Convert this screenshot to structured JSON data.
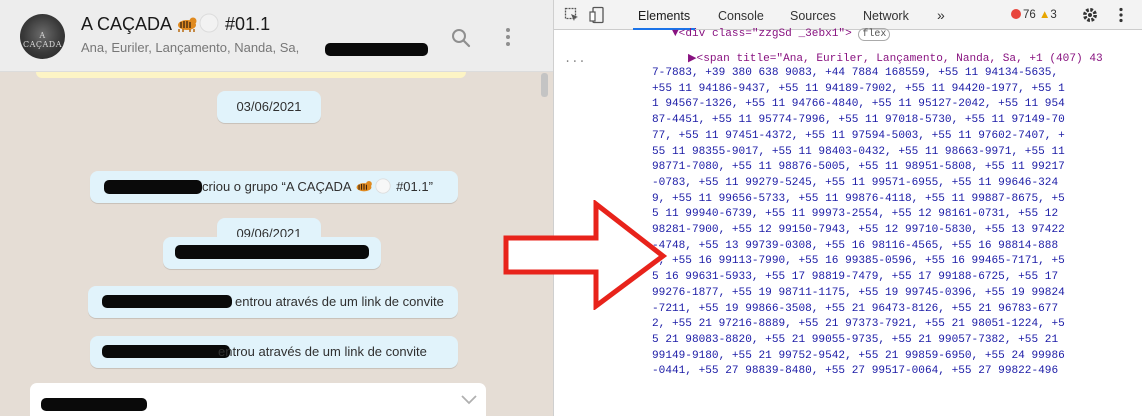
{
  "chat": {
    "avatar_text": "A CAÇADA",
    "title_prefix": "A CAÇADA ",
    "title_suffix": " #01.1",
    "subtitle": "Ana, Euriler, Lançamento, Nanda, Sa,",
    "icons": {
      "search": "search-icon",
      "menu": "kebab-menu-icon",
      "title_emoji": "tiger-emoji",
      "bubble": "chevron-down-icon"
    },
    "colors": {
      "panel_bg": "#e5ddd5",
      "system_pill": "#e1f3fb",
      "header_bg": "#ededed"
    },
    "messages": [
      {
        "text": "03/06/2021"
      },
      {
        "text": " criou o grupo “A CAÇADA ",
        "tail": " #01.1”"
      },
      {
        "text": "09/06/2021"
      },
      {
        "text": ""
      },
      {
        "text": "entrou através de um link de convite"
      },
      {
        "text": "entrou através de um link de convite"
      }
    ]
  },
  "devtools": {
    "tabs": [
      "Elements",
      "Console",
      "Sources",
      "Network",
      "»"
    ],
    "errors": "76",
    "warnings": "3",
    "icons": {
      "inspect": "inspect-element-icon",
      "device": "device-toolbar-icon",
      "settings": "gear-icon",
      "more": "vertical-dots-icon",
      "error": "error-dot-icon",
      "warning": "warning-triangle-icon"
    },
    "colors": {
      "tag": "#881280",
      "attr": "#994500",
      "value": "#1a1aa6",
      "active_tab": "#1a73e8"
    },
    "ellipsis": "...",
    "line0": {
      "pre": "▼<div class=\"zzgSd _3ebx1\">",
      "badge": "flex"
    },
    "line1": {
      "pre": "▶<span title=\"Ana, Euriler, Lançamento, Nanda, Sa, +1 (407) 43"
    },
    "code_lines": [
      "7-7883, +39 380 638 9083, +44 7884 168559, +55 11 94134-5635,",
      "+55 11 94186-9437, +55 11 94189-7902, +55 11 94420-1977, +55 1",
      "1 94567-1326, +55 11 94766-4840, +55 11 95127-2042, +55 11 954",
      "87-4451, +55 11 95774-7996, +55 11 97018-5730, +55 11 97149-70",
      "77, +55 11 97451-4372, +55 11 97594-5003, +55 11 97602-7407, +",
      "55 11 98355-9017, +55 11 98403-0432, +55 11 98663-9971, +55 11",
      "98771-7080, +55 11 98876-5005, +55 11 98951-5808, +55 11 99217",
      "-0783, +55 11 99279-5245, +55 11 99571-6955, +55 11 99646-324",
      "9, +55 11 99656-5733, +55 11 99876-4118, +55 11 99887-8675, +5",
      "5 11 99940-6739, +55 11 99973-2554, +55 12 98161-0731, +55 12",
      "98281-7900, +55 12 99150-7943, +55 12 99710-5830, +55 13 97422",
      "-4748, +55 13 99739-0308, +55 16 98116-4565, +55 16 98814-888",
      "0, +55 16 99113-7990, +55 16 99385-0596, +55 16 99465-7171, +5",
      "5 16 99631-5933, +55 17 98819-7479, +55 17 99188-6725, +55 17",
      "99276-1877, +55 19 98711-1175, +55 19 99745-0396, +55 19 99824",
      "-7211, +55 19 99866-3508, +55 21 96473-8126, +55 21 96783-677",
      "2, +55 21 97216-8889, +55 21 97373-7921, +55 21 98051-1224, +5",
      "5 21 98083-8820, +55 21 99055-9735, +55 21 99057-7382, +55 21",
      "99149-9180, +55 21 99752-9542, +55 21 99859-6950, +55 24 99986",
      "-0441, +55 27 98839-8480, +55 27 99517-0064, +55 27 99822-496"
    ]
  },
  "annotation": {
    "arrow_color": "#e8231b"
  }
}
